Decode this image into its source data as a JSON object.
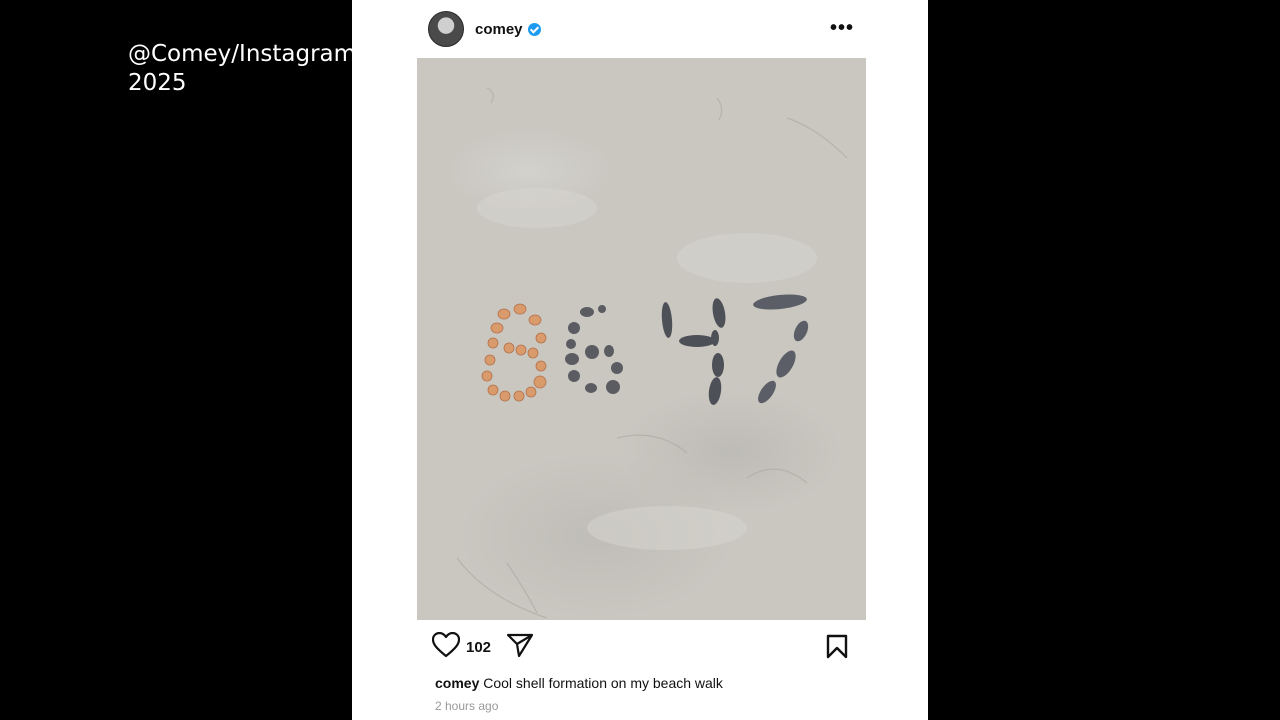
{
  "overlay": {
    "credit_line1": "@Comey/Instagram",
    "credit_line2": "2025"
  },
  "post": {
    "username": "comey",
    "verified": true,
    "more_icon": "more-horizontal-icon",
    "photo_text": "8647",
    "like_count": "102",
    "caption_username": "comey",
    "caption_text": "Cool shell formation on my beach walk",
    "timestamp": "2 hours ago"
  },
  "colors": {
    "background": "#000000",
    "panel": "#ffffff",
    "sand": "#c9c7c0",
    "verified_badge": "#1d9bf0",
    "timestamp": "#9a9a9a"
  }
}
